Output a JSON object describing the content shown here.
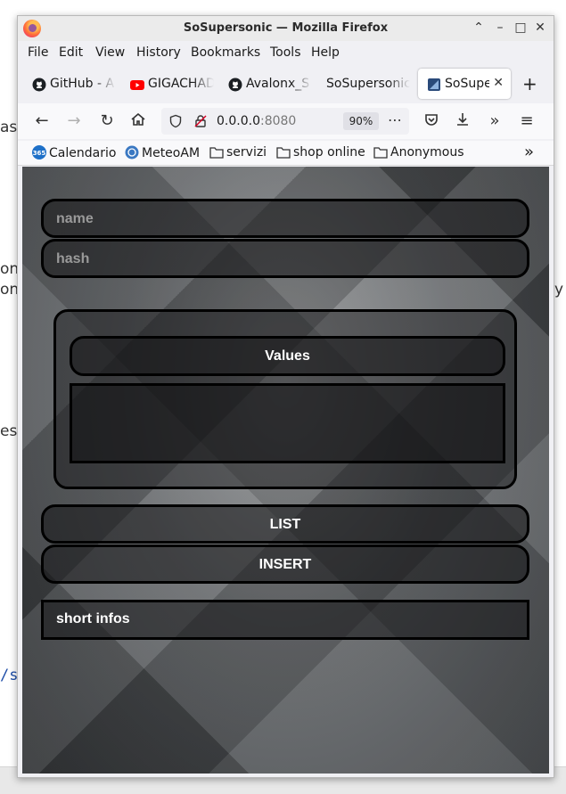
{
  "window": {
    "title": "SoSupersonic — Mozilla Firefox"
  },
  "menu": [
    "File",
    "Edit",
    "View",
    "History",
    "Bookmarks",
    "Tools",
    "Help"
  ],
  "tabs": [
    {
      "label": "GitHub - A",
      "icon": "github-icon"
    },
    {
      "label": "GIGACHAD",
      "icon": "youtube-icon"
    },
    {
      "label": "Avalonx_S",
      "icon": "github-icon"
    },
    {
      "label": "SoSupersonic",
      "icon": ""
    },
    {
      "label": "SoSuper",
      "icon": "site-icon",
      "active": true
    }
  ],
  "navbar": {
    "url_host": "0.0.0.0",
    "url_port": ":8080",
    "zoom": "90%"
  },
  "bookmarks": [
    {
      "label": "Calendario",
      "icon": "calendar-365-icon"
    },
    {
      "label": "MeteoAM",
      "icon": "weather-icon"
    },
    {
      "label": "servizi",
      "icon": "folder-icon"
    },
    {
      "label": "shop online",
      "icon": "folder-icon"
    },
    {
      "label": "Anonymous",
      "icon": "folder-icon"
    }
  ],
  "form": {
    "name_placeholder": "name",
    "hash_placeholder": "hash",
    "values_label": "Values",
    "values_content": "",
    "list_button": "LIST",
    "insert_button": "INSERT",
    "short_infos": "short infos"
  },
  "background_fragments": [
    "as",
    "on",
    "on",
    "y",
    "es",
    "/s"
  ],
  "colors": {
    "accent": "#000000",
    "text": "#ffffff",
    "placeholder": "#9a9a9a"
  }
}
